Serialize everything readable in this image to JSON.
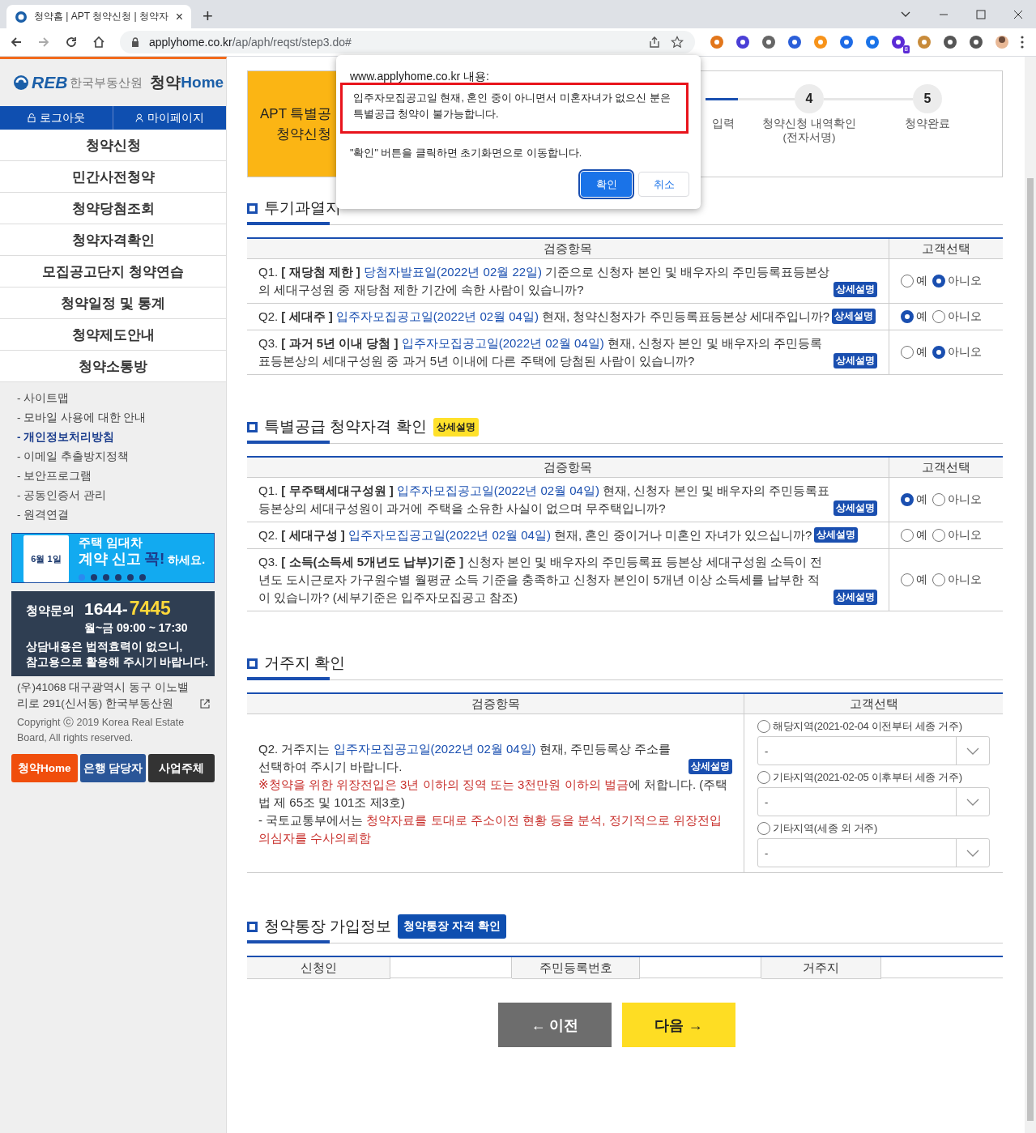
{
  "browser": {
    "tab_title": "청약홈 | APT 청약신청 | 청약자",
    "tab_close": "×",
    "new_tab": "+",
    "url_host": "applyhome.co.kr",
    "url_path": "/ap/aph/reqst/step3.do#",
    "extension_badge": "8"
  },
  "sidebar": {
    "logo_mark": "REB",
    "logo_org": "한국부동산원",
    "logo_service_a": "청약",
    "logo_service_b": "Home",
    "account": [
      {
        "label": "로그아웃",
        "kind": "logout"
      },
      {
        "label": "마이페이지",
        "kind": "mypage"
      }
    ],
    "menu": [
      "청약신청",
      "민간사전청약",
      "청약당첨조회",
      "청약자격확인",
      "모집공고단지 청약연습",
      "청약일정 및 통계",
      "청약제도안내",
      "청약소통방"
    ],
    "links": [
      {
        "label": "- 사이트맵",
        "emphasis": false
      },
      {
        "label": "- 모바일 사용에 대한 안내",
        "emphasis": false
      },
      {
        "label": "- 개인정보처리방침",
        "emphasis": true
      },
      {
        "label": "- 이메일 추출방지정책",
        "emphasis": false
      },
      {
        "label": "- 보안프로그램",
        "emphasis": false
      },
      {
        "label": "- 공동인증서 관리",
        "emphasis": false
      },
      {
        "label": "- 원격연결",
        "emphasis": false
      }
    ],
    "banner": {
      "doc_text": "6월 1일",
      "line1": "주택 임대차",
      "line2": "계약 신고",
      "line2_em": "꼭!",
      "line3": "하세요.",
      "dots": [
        {
          "selected": true
        },
        {
          "selected": false
        },
        {
          "selected": false
        },
        {
          "selected": false
        },
        {
          "selected": false
        },
        {
          "selected": false
        }
      ]
    },
    "contact": {
      "label": "청약문의",
      "phone_a": "1644-",
      "phone_b": "7445",
      "hours": "월~금 09:00 ~ 17:30",
      "notice": "상담내용은 법적효력이 없으니,\n참고용으로 활용해 주시기 바랍니다."
    },
    "address": "(우)41068 대구광역시 동구 이노밸리로 291(신서동) 한국부동산원",
    "copyright": "Copyright ⓒ 2019 Korea Real Estate Board, All rights reserved.",
    "buttons": [
      {
        "label": "청약Home",
        "kind": "home"
      },
      {
        "label": "은행 담당자",
        "kind": "bank"
      },
      {
        "label": "사업주체",
        "kind": "business"
      }
    ]
  },
  "steps": {
    "current_title": "APT 특별공",
    "current_sub": "청약신청",
    "partial_label": "입력",
    "items": [
      {
        "number": "4",
        "label": "청약신청 내역확인",
        "sub": "(전자서명)"
      },
      {
        "number": "5",
        "label": "청약완료"
      }
    ]
  },
  "sections": [
    {
      "kind": "check",
      "title": "투기과열지",
      "columns": [
        "검증항목",
        "고객선택"
      ],
      "rows": [
        {
          "segments": [
            {
              "kind": "plain",
              "text": "Q1. "
            },
            {
              "kind": "bold",
              "text": "[ 재당첨 제한 ]"
            },
            {
              "kind": "link",
              "text": " 당첨자발표일(2022년 02월 22일)"
            },
            {
              "kind": "plain",
              "text": " 기준으로 신청자 본인 및 배우자의 주민등록표등본상의 세대구성원 중 재당첨 제한 기간에 속한 사람이 있습니까?"
            }
          ],
          "badge": "상세설명",
          "options": [
            {
              "label": "예",
              "selected": false
            },
            {
              "label": "아니오",
              "selected": true
            }
          ]
        },
        {
          "segments": [
            {
              "kind": "plain",
              "text": "Q2. "
            },
            {
              "kind": "bold",
              "text": "[ 세대주 ]"
            },
            {
              "kind": "link",
              "text": " 입주자모집공고일(2022년 02월 04일)"
            },
            {
              "kind": "plain",
              "text": " 현재, 청약신청자가 주민등록표등본상 세대주입니까?"
            }
          ],
          "badge": "상세설명",
          "options": [
            {
              "label": "예",
              "selected": true
            },
            {
              "label": "아니오",
              "selected": false
            }
          ]
        },
        {
          "segments": [
            {
              "kind": "plain",
              "text": "Q3. "
            },
            {
              "kind": "bold",
              "text": "[ 과거 5년 이내 당첨 ]"
            },
            {
              "kind": "link",
              "text": " 입주자모집공고일(2022년 02월 04일)"
            },
            {
              "kind": "plain",
              "text": " 현재, 신청자 본인 및 배우자의 주민등록표등본상의 세대구성원 중 과거 5년 이내에 다른 주택에 당첨된 사람이 있습니까?"
            }
          ],
          "badge": "상세설명",
          "options": [
            {
              "label": "예",
              "selected": false
            },
            {
              "label": "아니오",
              "selected": true
            }
          ]
        }
      ]
    },
    {
      "kind": "check",
      "title": "특별공급 청약자격 확인",
      "badge": "상세설명",
      "columns": [
        "검증항목",
        "고객선택"
      ],
      "rows": [
        {
          "segments": [
            {
              "kind": "plain",
              "text": "Q1. "
            },
            {
              "kind": "bold",
              "text": "[ 무주택세대구성원 ]"
            },
            {
              "kind": "link",
              "text": " 입주자모집공고일(2022년 02월 04일)"
            },
            {
              "kind": "plain",
              "text": " 현재, 신청자 본인 및 배우자의 주민등록표등본상의 세대구성원이 과거에 주택을 소유한 사실이 없으며 무주택입니까?"
            }
          ],
          "badge": "상세설명",
          "options": [
            {
              "label": "예",
              "selected": true
            },
            {
              "label": "아니오",
              "selected": false
            }
          ]
        },
        {
          "segments": [
            {
              "kind": "plain",
              "text": "Q2. "
            },
            {
              "kind": "bold",
              "text": "[ 세대구성 ]"
            },
            {
              "kind": "link",
              "text": " 입주자모집공고일(2022년 02월 04일)"
            },
            {
              "kind": "plain",
              "text": " 현재, 혼인 중이거나 미혼인 자녀가 있으십니까?"
            }
          ],
          "badge": "상세설명",
          "options": [
            {
              "label": "예",
              "selected": false
            },
            {
              "label": "아니오",
              "selected": false
            }
          ]
        },
        {
          "segments": [
            {
              "kind": "plain",
              "text": "Q3. "
            },
            {
              "kind": "bold",
              "text": "[ 소득(소득세 5개년도 납부)기준 ]"
            },
            {
              "kind": "plain",
              "text": " 신청자 본인 및 배우자의 주민등록표 등본상 세대구성원 소득이 전년도 도시근로자 가구원수별 월평균 소득 기준을 충족하고 신청자 본인이 5개년 이상 소득세를 납부한 적이 있습니까? (세부기준은 입주자모집공고 참조)"
            }
          ],
          "badge": "상세설명",
          "options": [
            {
              "label": "예",
              "selected": false
            },
            {
              "label": "아니오",
              "selected": false
            }
          ]
        }
      ]
    },
    {
      "kind": "residence",
      "title": "거주지 확인",
      "columns": [
        "검증항목",
        "고객선택"
      ],
      "question": [
        {
          "kind": "plain",
          "text": "Q2. 거주지는 "
        },
        {
          "kind": "link",
          "text": "입주자모집공고일(2022년 02월 04일)"
        },
        {
          "kind": "plain",
          "text": " 현재, 주민등록상 주소를 선택하여 주시기 바랍니다."
        }
      ],
      "question_badge": "상세설명",
      "warning": [
        {
          "kind": "red",
          "text": "※청약을 위한 위장전입은 3년 이하의 징역 또는 3천만원 이하의 벌금"
        },
        {
          "kind": "plain",
          "text": "에 처합니다. (주택법 제 65조 및 101조 제3호)"
        }
      ],
      "note": [
        {
          "kind": "plain",
          "text": "- 국토교통부에서는 "
        },
        {
          "kind": "red",
          "text": "청약자료를 토대로 주소이전 현황 등을 분석, 정기적으로 위장전입 의심자를 수사의뢰함"
        }
      ],
      "options": [
        {
          "label": "해당지역(2021-02-04 이전부터 세종 거주)",
          "selected": false,
          "value": "-"
        },
        {
          "label": "기타지역(2021-02-05 이후부터 세종 거주)",
          "selected": false,
          "value": "-"
        },
        {
          "label": "기타지역(세종 외 거주)",
          "selected": false,
          "value": "-"
        }
      ]
    }
  ],
  "account_info": {
    "title": "청약통장 가입정보",
    "button": "청약통장 자격 확인",
    "columns": [
      "신청인",
      "주민등록번호",
      "거주지"
    ]
  },
  "nav_buttons": [
    {
      "label": "← 이전",
      "kind": "prev"
    },
    {
      "label": "다음 →",
      "kind": "next"
    }
  ],
  "dialog": {
    "origin": "www.applyhome.co.kr 내용:",
    "message": "입주자모집공고일 현재, 혼인 중이 아니면서 미혼자녀가 없으신 분은\n특별공급 청약이 불가능합니다.",
    "note": "\"확인\" 버튼을 클릭하면 초기화면으로 이동합니다.",
    "buttons": [
      {
        "label": "확인",
        "kind": "primary"
      },
      {
        "label": "취소",
        "kind": "secondary"
      }
    ]
  }
}
